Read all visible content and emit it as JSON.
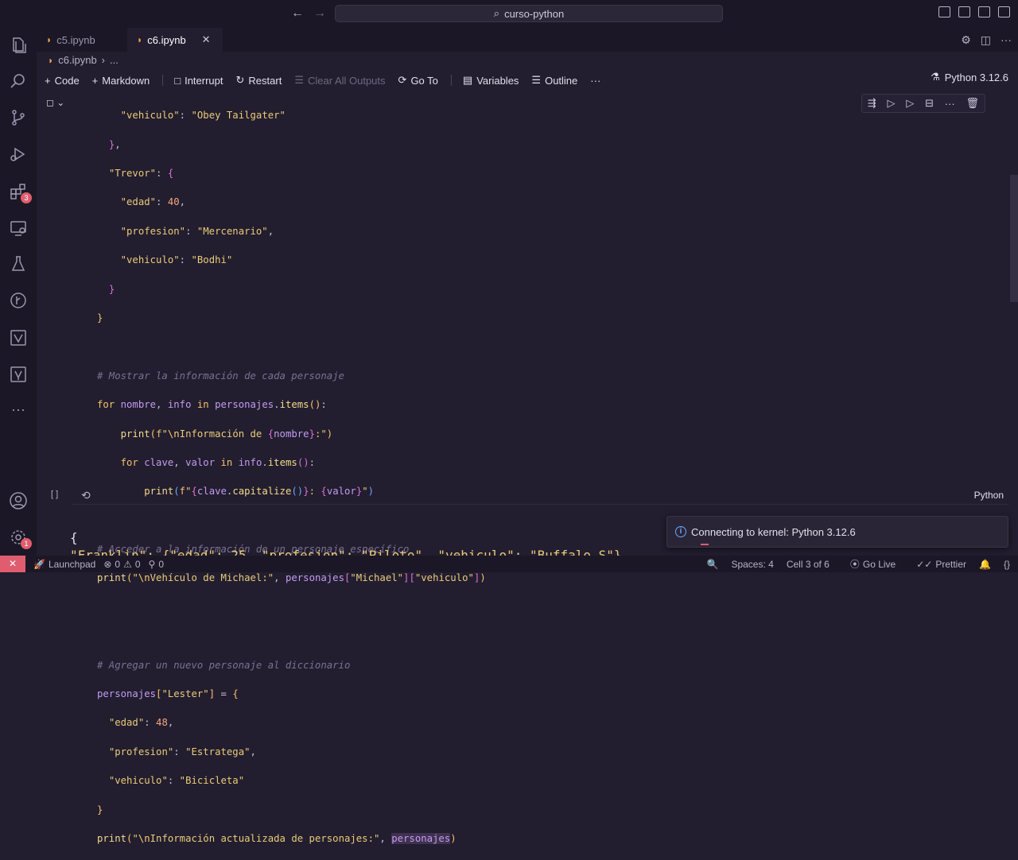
{
  "window": {
    "search_text": "curso-python"
  },
  "tabs": [
    {
      "label": "c5.ipynb",
      "active": false
    },
    {
      "label": "c6.ipynb",
      "active": true
    }
  ],
  "breadcrumb": {
    "file": "c6.ipynb",
    "rest": "..."
  },
  "activity_bar": {
    "extensions_badge": "3",
    "settings_badge": "1"
  },
  "toolbar": {
    "code": "Code",
    "markdown": "Markdown",
    "interrupt": "Interrupt",
    "restart": "Restart",
    "clear_outputs": "Clear All Outputs",
    "goto": "Go To",
    "variables": "Variables",
    "outline": "Outline",
    "more": "···",
    "kernel": "Python 3.12.6"
  },
  "cell": {
    "execution_count": "[ ]",
    "language": "Python"
  },
  "output": {
    "line1": "{",
    "line2": "\"Franklin\": {\"edad\": 25, \"profesion\": \"Piloto\", \"vehiculo\": \"Buffalo S\"}"
  },
  "toast": {
    "message": "Connecting to kernel: Python 3.12.6"
  },
  "status_bar": {
    "remote": "✕",
    "launchpad": "Launchpad",
    "errors": "0",
    "warnings": "0",
    "ports": "0",
    "spaces": "Spaces: 4",
    "cell_pos": "Cell 3 of 6",
    "go_live": "Go Live",
    "prettier": "Prettier",
    "braces": "{}"
  },
  "colors": {
    "background": "#221d2f",
    "chrome": "#1b1726",
    "accent_red": "#e05d6f",
    "string": "#e9cc78",
    "keyword": "#ff79c6"
  }
}
